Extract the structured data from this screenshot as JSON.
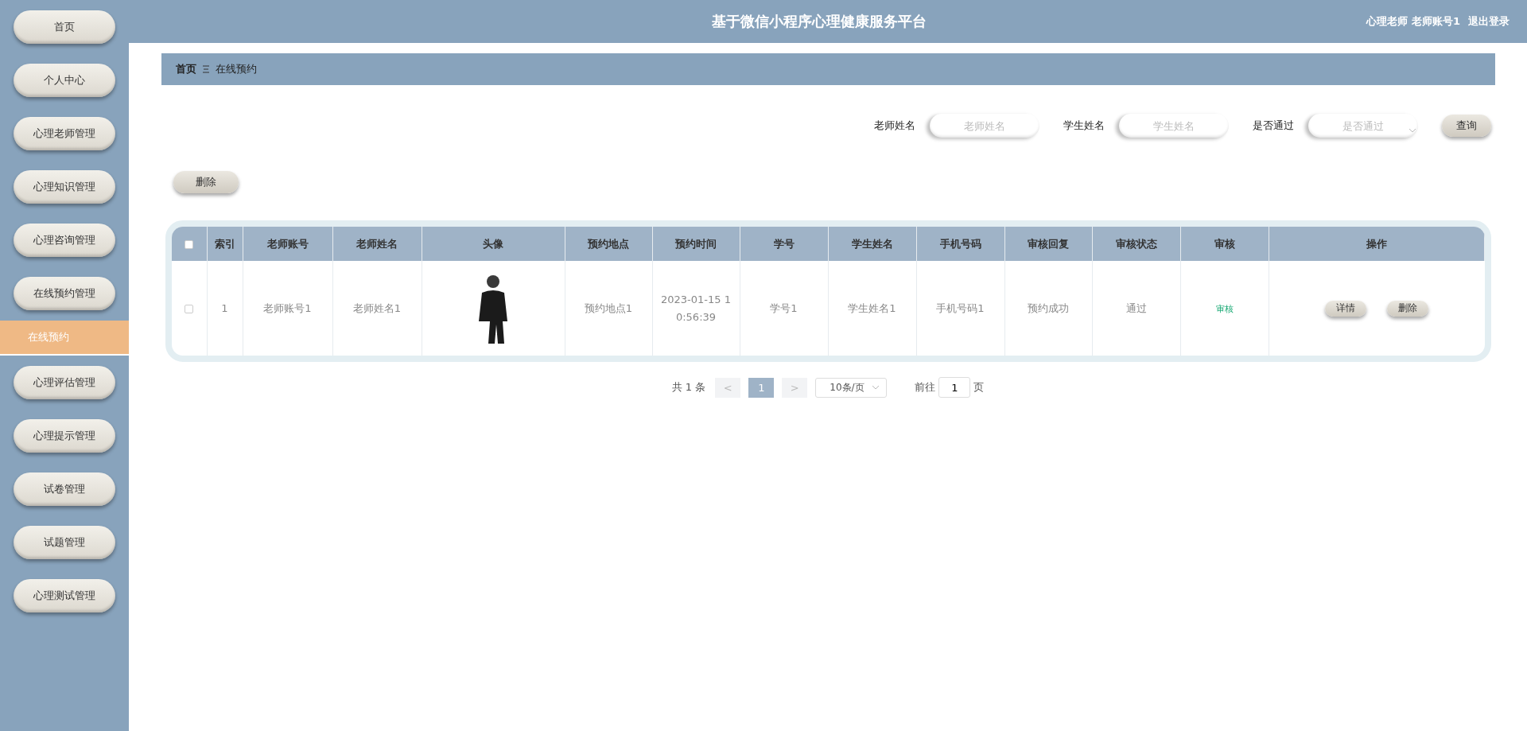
{
  "header": {
    "title": "基于微信小程序心理健康服务平台",
    "user": "心理老师 老师账号1",
    "logout": "退出登录"
  },
  "sidebar": {
    "items": [
      {
        "label": "首页",
        "kind": "menu",
        "selected": false
      },
      {
        "label": "个人中心",
        "kind": "menu",
        "selected": false
      },
      {
        "label": "心理老师管理",
        "kind": "menu",
        "selected": false
      },
      {
        "label": "心理知识管理",
        "kind": "menu",
        "selected": false
      },
      {
        "label": "心理咨询管理",
        "kind": "menu",
        "selected": false
      },
      {
        "label": "在线预约管理",
        "kind": "menu",
        "selected": false
      },
      {
        "label": "在线预约",
        "kind": "submenu",
        "selected": true
      },
      {
        "label": "心理评估管理",
        "kind": "menu",
        "selected": false
      },
      {
        "label": "心理提示管理",
        "kind": "menu",
        "selected": false
      },
      {
        "label": "试卷管理",
        "kind": "menu",
        "selected": false
      },
      {
        "label": "试题管理",
        "kind": "menu",
        "selected": false
      },
      {
        "label": "心理测试管理",
        "kind": "menu",
        "selected": false
      }
    ]
  },
  "breadcrumb": [
    "首页",
    "在线预约"
  ],
  "search": {
    "fields": [
      {
        "label": "老师姓名",
        "placeholder": "老师姓名",
        "kind": "input"
      },
      {
        "label": "学生姓名",
        "placeholder": "学生姓名",
        "kind": "input"
      },
      {
        "label": "是否通过",
        "placeholder": "是否通过",
        "kind": "select"
      }
    ],
    "button": "查询"
  },
  "actions": [
    "删除"
  ],
  "table": {
    "all_checked": false,
    "columns": [
      "索引",
      "老师账号",
      "老师姓名",
      "头像",
      "预约地点",
      "预约时间",
      "学号",
      "学生姓名",
      "手机号码",
      "审核回复",
      "审核状态",
      "审核",
      "操作"
    ],
    "rows": [
      {
        "checked": false,
        "index": "1",
        "teacher_account": "老师账号1",
        "teacher_name": "老师姓名1",
        "location": "预约地点1",
        "time": "2023-01-15 10:56:39",
        "student_no": "学号1",
        "student_name": "学生姓名1",
        "phone": "手机号码1",
        "reply": "预约成功",
        "status": "通过",
        "review": "审核",
        "buttons": [
          "详情",
          "删除"
        ]
      }
    ]
  },
  "pagination": {
    "total": "共 1 条",
    "prev": "<",
    "pages": [
      {
        "label": "1",
        "selected": true
      }
    ],
    "next": ">",
    "page_size": "10条/页",
    "goto_label": "前往",
    "goto_value": "1",
    "goto_suffix": "页"
  }
}
